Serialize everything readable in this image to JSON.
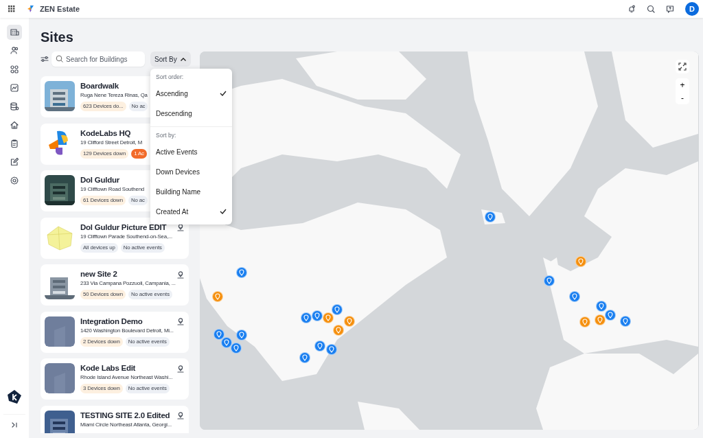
{
  "topbar": {
    "app_name": "ZEN Estate",
    "avatar": "D"
  },
  "rail": [
    {
      "kind": "building",
      "selected": true
    },
    {
      "kind": "users",
      "selected": false
    },
    {
      "kind": "grid",
      "selected": false
    },
    {
      "kind": "chart",
      "selected": false
    },
    {
      "kind": "database",
      "selected": false
    },
    {
      "kind": "home",
      "selected": false
    },
    {
      "kind": "clipboard",
      "selected": false
    },
    {
      "kind": "edit",
      "selected": false
    },
    {
      "kind": "settings",
      "selected": false
    }
  ],
  "page_title": "Sites",
  "search": {
    "placeholder": "Search for Buildings"
  },
  "sort_button": "Sort By",
  "sort_menu": {
    "order_heading": "Sort order:",
    "order_options": [
      {
        "label": "Ascending",
        "checked": true
      },
      {
        "label": "Descending",
        "checked": false
      }
    ],
    "by_heading": "Sort by:",
    "by_options": [
      {
        "label": "Active Events",
        "checked": false
      },
      {
        "label": "Down Devices",
        "checked": false
      },
      {
        "label": "Building Name",
        "checked": false
      },
      {
        "label": "Created At",
        "checked": true
      }
    ]
  },
  "sites": [
    {
      "name": "Boardwalk",
      "address": "Ruga Nene Tereza Rinas, Qa",
      "geo": false,
      "badges": [
        {
          "text": "623 Devices do...",
          "kind": "down"
        },
        {
          "text": "No ac",
          "kind": "info"
        }
      ]
    },
    {
      "name": "KodeLabs HQ",
      "address": "19 Clifford Street Detroit, M",
      "geo": false,
      "badges": [
        {
          "text": "129 Devices down",
          "kind": "down"
        },
        {
          "text": "1 Ac",
          "kind": "event"
        }
      ]
    },
    {
      "name": "Dol Guldur",
      "address": "19 Clifftown Road Southend",
      "geo": false,
      "badges": [
        {
          "text": "61 Devices down",
          "kind": "down"
        },
        {
          "text": "No ac",
          "kind": "info"
        }
      ]
    },
    {
      "name": "Dol Guldur Picture EDIT",
      "address": "19 Clifftown Parade Southend-on-Sea,...",
      "geo": true,
      "badges": [
        {
          "text": "All devices up",
          "kind": "info"
        },
        {
          "text": "No active events",
          "kind": "info"
        }
      ]
    },
    {
      "name": "new Site 2",
      "address": "233 Via Campana Pozzuoli, Campania, ...",
      "geo": true,
      "badges": [
        {
          "text": "50 Devices down",
          "kind": "down"
        },
        {
          "text": "No active events",
          "kind": "info"
        }
      ]
    },
    {
      "name": "Integration Demo",
      "address": "1420 Washington Boulevard Detroit, Mi...",
      "geo": true,
      "badges": [
        {
          "text": "2 Devices down",
          "kind": "down"
        },
        {
          "text": "No active events",
          "kind": "info"
        }
      ]
    },
    {
      "name": "Kode Labs Edit",
      "address": "Rhode Island Avenue Northeast Washi...",
      "geo": true,
      "badges": [
        {
          "text": "3 Devices down",
          "kind": "down"
        },
        {
          "text": "No active events",
          "kind": "info"
        }
      ]
    },
    {
      "name": "TESTING SITE 2.0 Edited",
      "address": "Miami Circle Northeast Atlanta, Georgi...",
      "geo": true
    }
  ],
  "map": {
    "zoom_in": "+",
    "zoom_out": "-",
    "markers": [
      {
        "color": "#1a7ff0"
      },
      {
        "color": "#f5900f"
      },
      {
        "color": "#1a7ff0"
      },
      {
        "color": "#1a7ff0"
      },
      {
        "color": "#1a7ff0"
      },
      {
        "color": "#1a7ff0"
      },
      {
        "color": "#f5900f"
      },
      {
        "color": "#f5900f"
      },
      {
        "color": "#1a7ff0"
      },
      {
        "color": "#1a7ff0"
      },
      {
        "color": "#f5900f"
      },
      {
        "color": "#1a7ff0"
      },
      {
        "color": "#1a7ff0"
      },
      {
        "color": "#f5900f"
      },
      {
        "color": "#1a7ff0"
      },
      {
        "color": "#f5900f"
      },
      {
        "color": "#f5900f"
      },
      {
        "color": "#1a7ff0"
      },
      {
        "color": "#1a7ff0"
      },
      {
        "color": "#1a7ff0"
      },
      {
        "color": "#1a7ff0"
      },
      {
        "color": "#1a7ff0"
      },
      {
        "color": "#1a7ff0"
      },
      {
        "color": "#1a7ff0"
      }
    ]
  }
}
